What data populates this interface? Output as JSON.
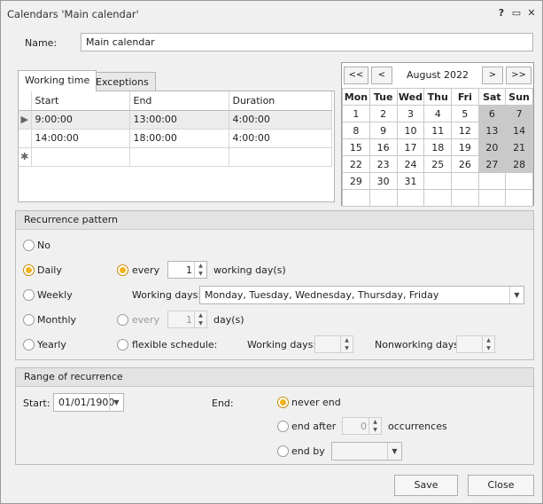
{
  "window": {
    "title": "Calendars 'Main calendar'",
    "help_glyph": "?",
    "maximize_glyph": "▭",
    "close_glyph": "✕"
  },
  "name": {
    "label": "Name:",
    "value": "Main calendar"
  },
  "tabs": [
    {
      "label": "Working time",
      "active": true
    },
    {
      "label": "Exceptions",
      "active": false
    }
  ],
  "working_time": {
    "columns": [
      "Start",
      "End",
      "Duration"
    ],
    "rows": [
      {
        "start": "9:00:00",
        "end": "13:00:00",
        "duration": "4:00:00"
      },
      {
        "start": "14:00:00",
        "end": "18:00:00",
        "duration": "4:00:00"
      }
    ],
    "row_indicator": "▶",
    "new_row_indicator": "✱"
  },
  "calendar": {
    "prev_year": "<<",
    "prev_month": "<",
    "next_month": ">",
    "next_year": ">>",
    "month_label": "August 2022",
    "weekdays": [
      "Mon",
      "Tue",
      "Wed",
      "Thu",
      "Fri",
      "Sat",
      "Sun"
    ],
    "weeks": [
      [
        "1",
        "2",
        "3",
        "4",
        "5",
        "6",
        "7"
      ],
      [
        "8",
        "9",
        "10",
        "11",
        "12",
        "13",
        "14"
      ],
      [
        "15",
        "16",
        "17",
        "18",
        "19",
        "20",
        "21"
      ],
      [
        "22",
        "23",
        "24",
        "25",
        "26",
        "27",
        "28"
      ],
      [
        "29",
        "30",
        "31",
        "",
        "",
        "",
        ""
      ],
      [
        "",
        "",
        "",
        "",
        "",
        "",
        ""
      ]
    ]
  },
  "recurrence": {
    "title": "Recurrence pattern",
    "options": {
      "no": "No",
      "daily": "Daily",
      "weekly": "Weekly",
      "monthly": "Monthly",
      "yearly": "Yearly"
    },
    "selected": "daily",
    "every_label": "every",
    "every_value": "1",
    "every_unit": "working day(s)",
    "working_days_label": "Working days:",
    "working_days_value": "Monday, Tuesday, Wednesday, Thursday, Friday",
    "every2_label": "every",
    "every2_value": "1",
    "every2_unit": "day(s)",
    "flexible_label": "flexible schedule:",
    "flex_working_days_label": "Working days:",
    "flex_nonworking_days_label": "Nonworking days:"
  },
  "range": {
    "title": "Range of recurrence",
    "start_label": "Start:",
    "start_value": "01/01/1900",
    "end_label": "End:",
    "never_end": "never end",
    "end_after": "end after",
    "end_after_value": "0",
    "occurrences": "occurrences",
    "end_by": "end by"
  },
  "buttons": {
    "save": "Save",
    "close": "Close"
  },
  "colors": {
    "accent": "#f2b31f",
    "weekend": "#c9c9c9"
  }
}
